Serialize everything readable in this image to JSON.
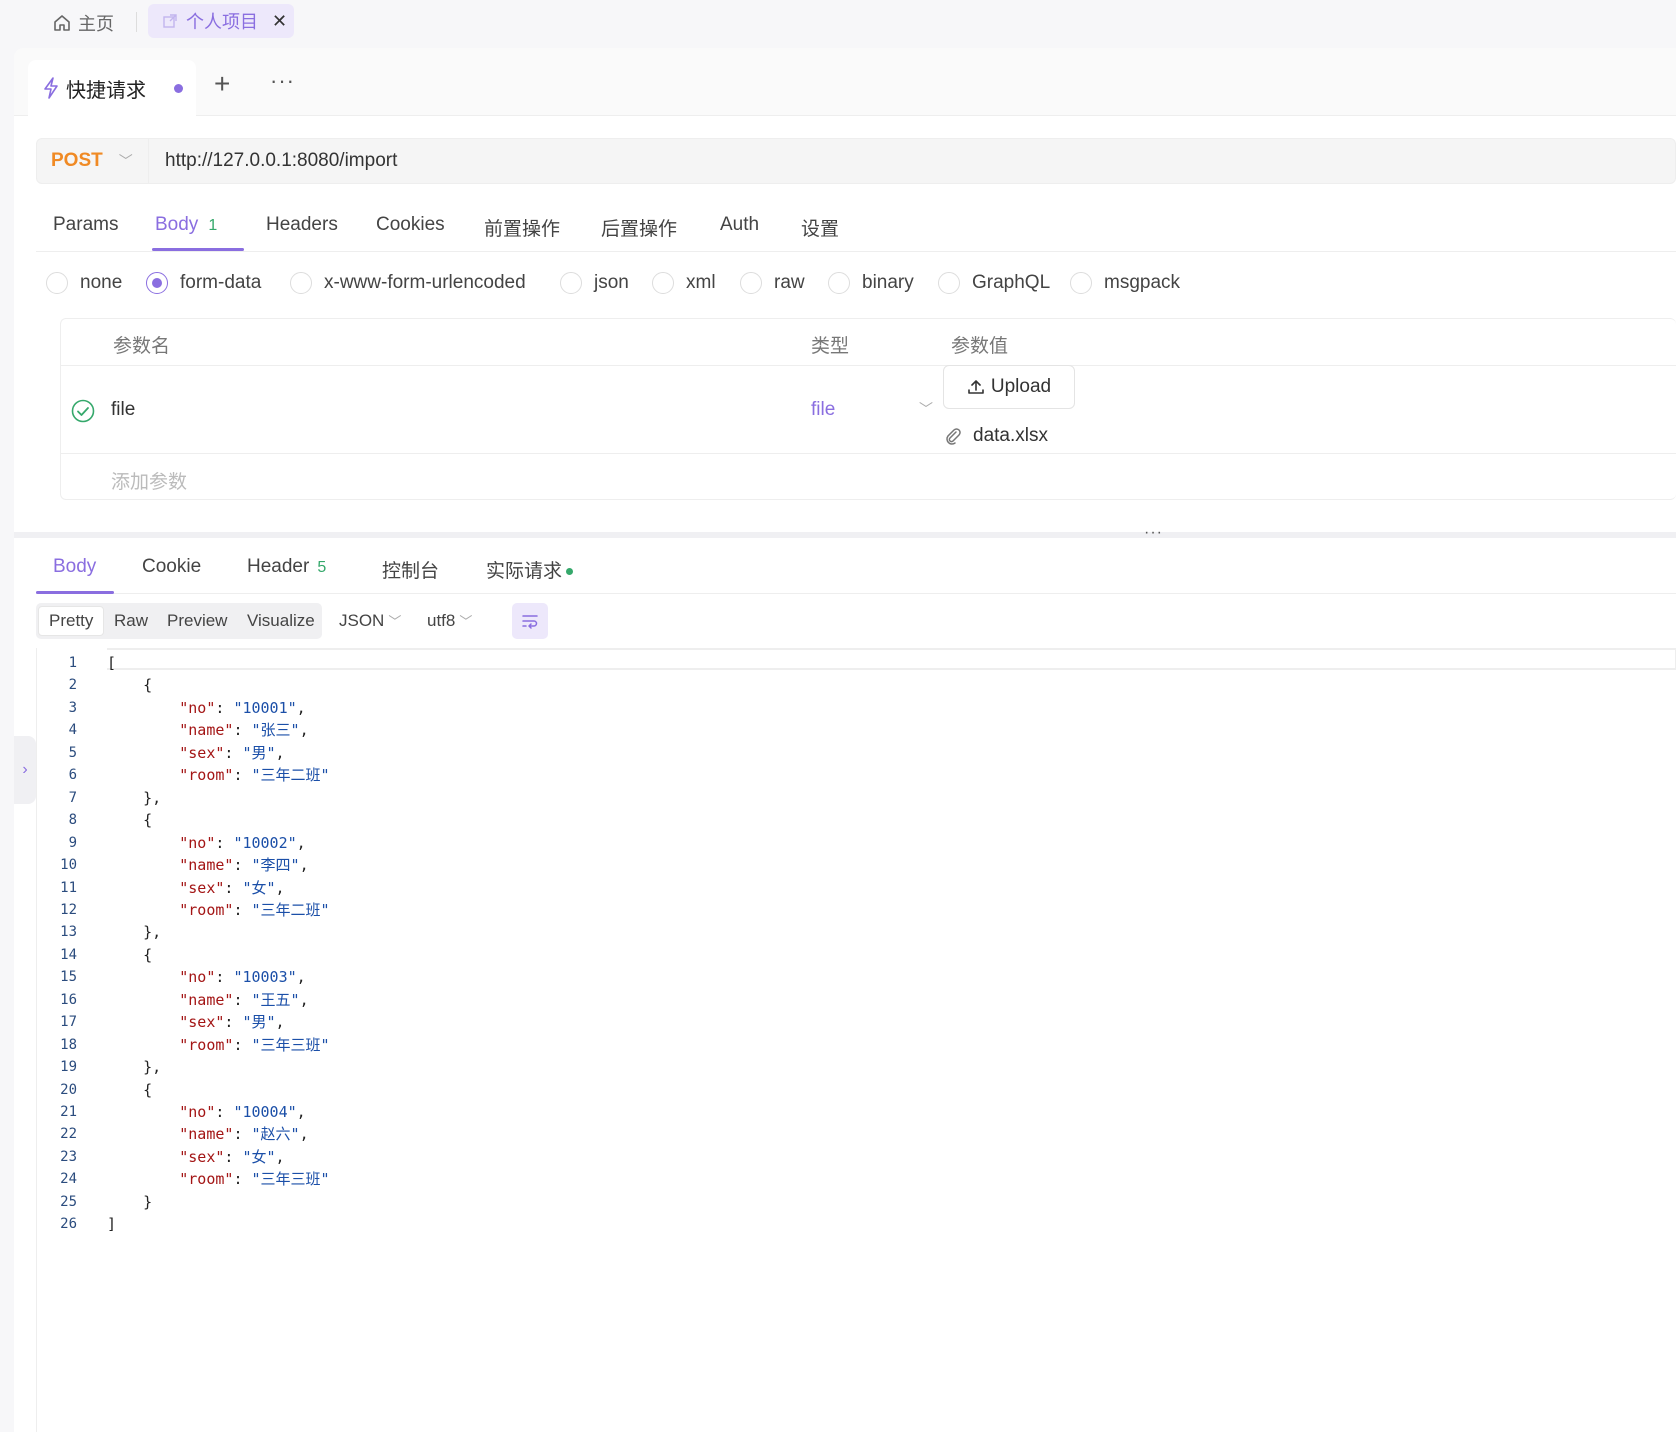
{
  "topbar": {
    "home_label": "主页",
    "project_tab_label": "个人项目",
    "close_glyph": "✕"
  },
  "request_tab": {
    "label": "快捷请求",
    "plus_glyph": "+",
    "more_glyph": "···"
  },
  "request": {
    "method": "POST",
    "url": "http://127.0.0.1:8080/import"
  },
  "request_tabs": [
    {
      "label": "Params"
    },
    {
      "label": "Body",
      "badge": "1",
      "active": true
    },
    {
      "label": "Headers"
    },
    {
      "label": "Cookies"
    },
    {
      "label": "前置操作"
    },
    {
      "label": "后置操作"
    },
    {
      "label": "Auth"
    },
    {
      "label": "设置"
    }
  ],
  "body_types": [
    "none",
    "form-data",
    "x-www-form-urlencoded",
    "json",
    "xml",
    "raw",
    "binary",
    "GraphQL",
    "msgpack"
  ],
  "body_type_selected": "form-data",
  "params_table": {
    "headers": {
      "name": "参数名",
      "type": "类型",
      "value": "参数值"
    },
    "rows": [
      {
        "name": "file",
        "type": "file",
        "upload_label": "Upload",
        "file_name": "data.xlsx"
      }
    ],
    "add_placeholder": "添加参数"
  },
  "splitter": {
    "dots": "···"
  },
  "response_tabs": [
    {
      "label": "Body",
      "active": true
    },
    {
      "label": "Cookie"
    },
    {
      "label": "Header",
      "badge": "5"
    },
    {
      "label": "控制台"
    },
    {
      "label": "实际请求"
    }
  ],
  "view_modes": [
    "Pretty",
    "Raw",
    "Preview",
    "Visualize"
  ],
  "view_mode_selected": "Pretty",
  "format_select": "JSON",
  "encoding_select": "utf8",
  "response_json": [
    {
      "no": "10001",
      "name": "张三",
      "sex": "男",
      "room": "三年二班"
    },
    {
      "no": "10002",
      "name": "李四",
      "sex": "女",
      "room": "三年二班"
    },
    {
      "no": "10003",
      "name": "王五",
      "sex": "男",
      "room": "三年三班"
    },
    {
      "no": "10004",
      "name": "赵六",
      "sex": "女",
      "room": "三年三班"
    }
  ],
  "colors": {
    "accent": "#8a6ee0",
    "method": "#f08a24",
    "success": "#35a86b",
    "json_key": "#a31515",
    "json_string": "#1b4fa8"
  },
  "icons": {
    "home": "home-icon",
    "project": "external-link-icon",
    "request": "lightning-icon",
    "check": "check-circle-icon",
    "upload": "upload-icon",
    "attach": "paperclip-icon",
    "wrap": "word-wrap-icon",
    "expand": "chevron-right-icon"
  }
}
